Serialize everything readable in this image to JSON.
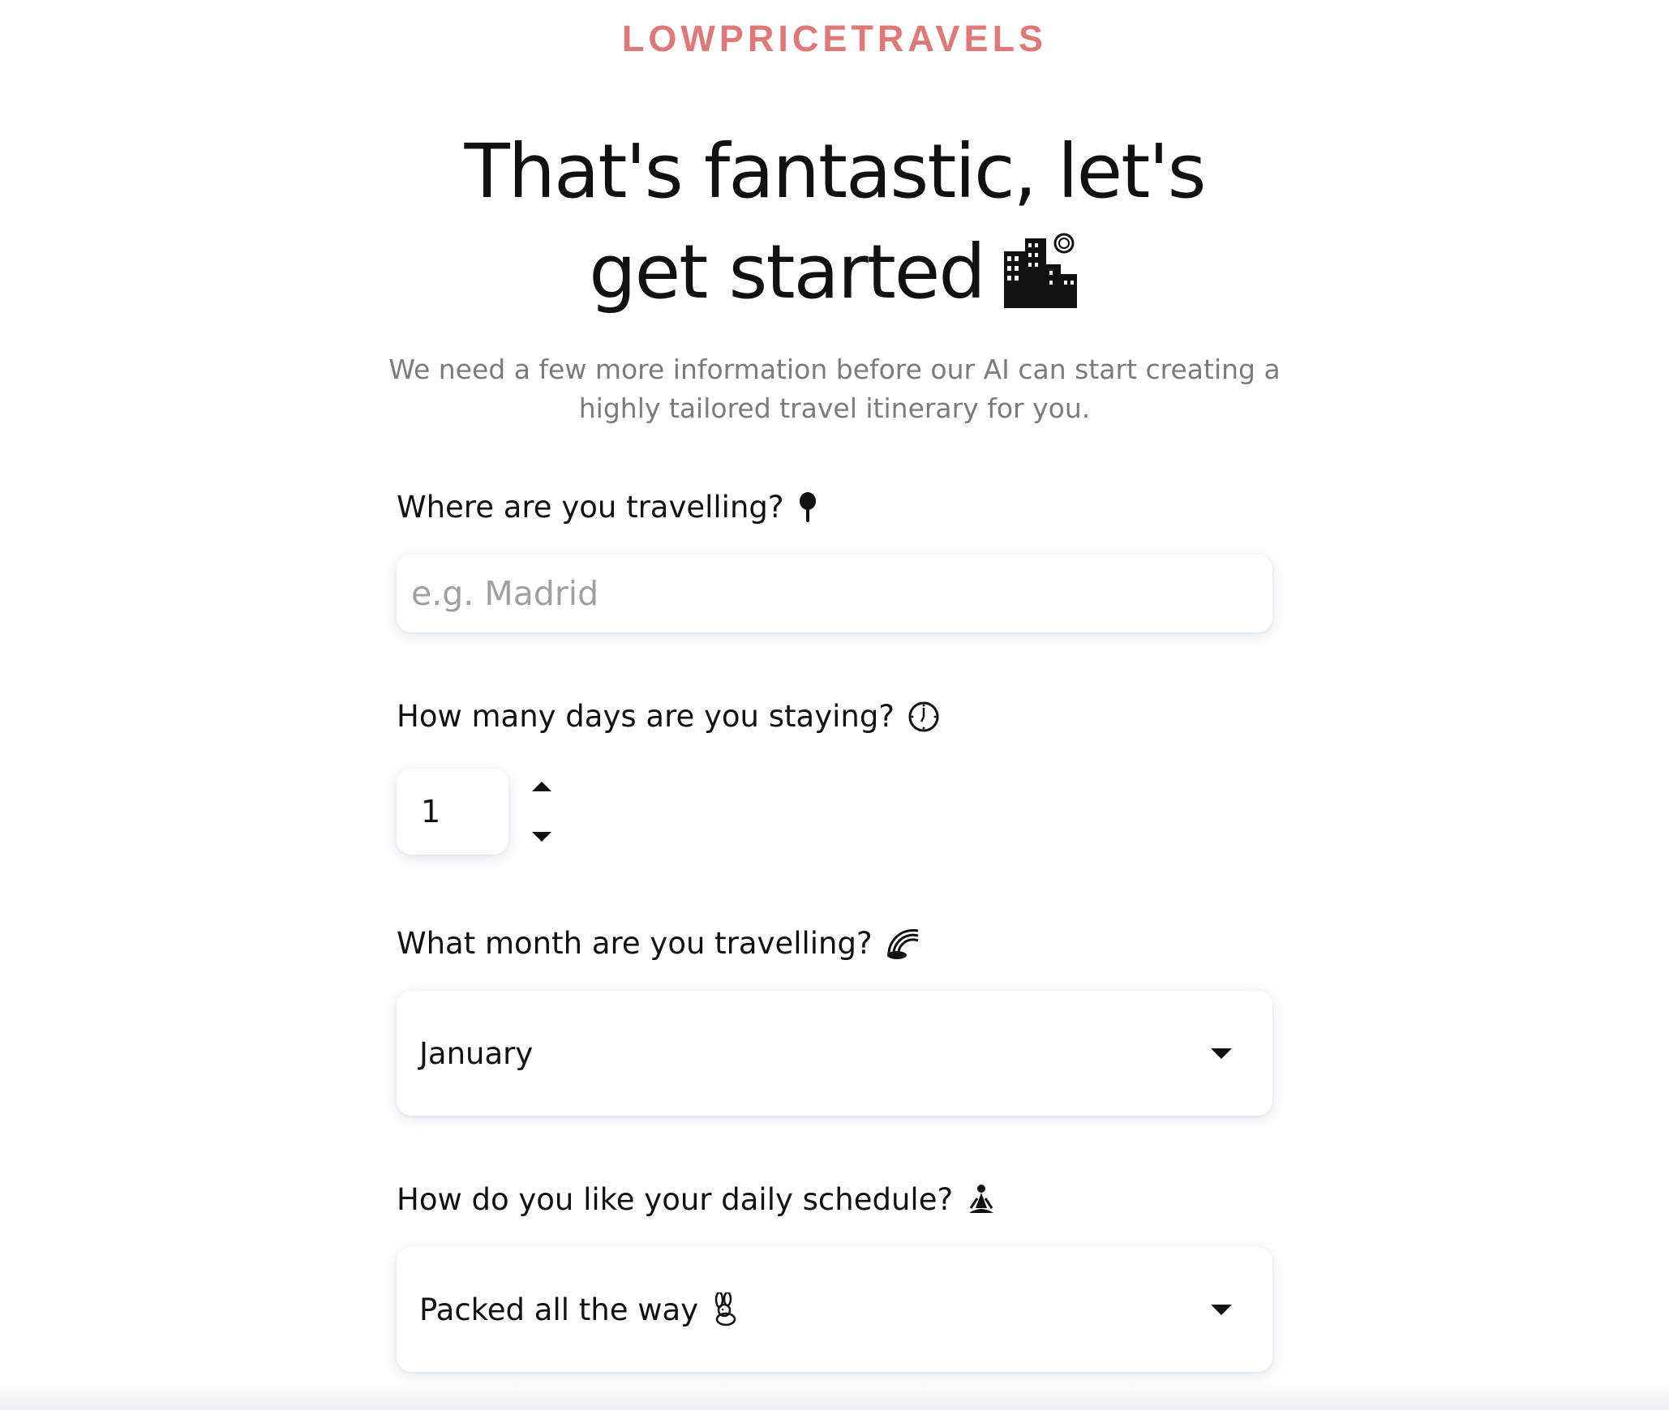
{
  "brand": {
    "name": "LOWPRICETRAVELS",
    "color": "#e07878"
  },
  "hero": {
    "title": "That's fantastic, let's get started",
    "emoji_icon": "cityscape-icon",
    "subtitle": "We need a few more information before our AI can start creating a highly tailored travel itinerary for you."
  },
  "form": {
    "destination": {
      "label": "Where are you travelling?",
      "icon": "pushpin-icon",
      "placeholder": "e.g. Madrid",
      "value": ""
    },
    "days": {
      "label": "How many days are you staying?",
      "icon": "clock-icon",
      "value": "1"
    },
    "month": {
      "label": "What month are you travelling?",
      "icon": "rainbow-icon",
      "selected": "January"
    },
    "schedule": {
      "label": "How do you like your daily schedule?",
      "icon": "meditation-icon",
      "selected": "Packed all the way",
      "selected_icon": "rabbit-icon"
    }
  }
}
